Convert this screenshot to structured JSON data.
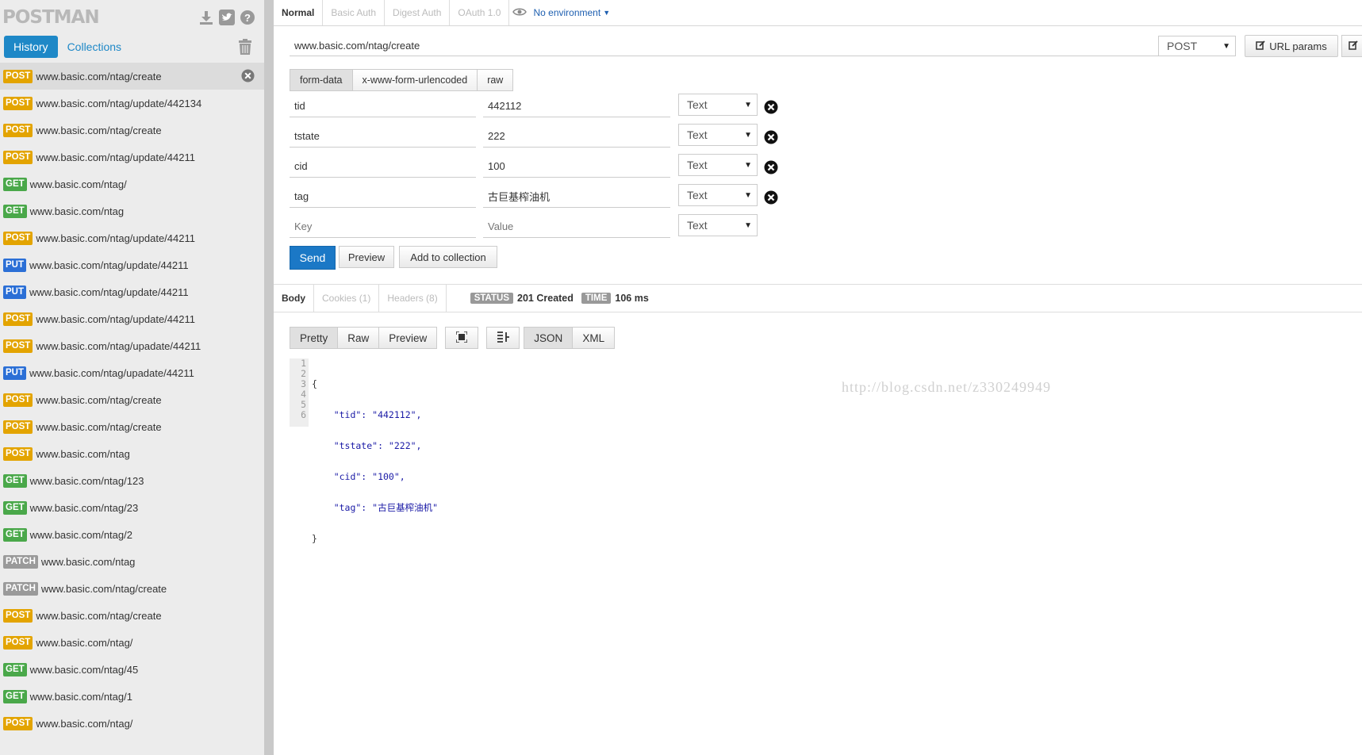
{
  "app": {
    "logo": "POSTMAN"
  },
  "sidebar": {
    "tabs": {
      "history": "History",
      "collections": "Collections"
    },
    "method_colors": {
      "POST": "#e3a400",
      "GET": "#4aa84a",
      "PUT": "#2b6fd6",
      "PATCH": "#9a9a9a"
    },
    "history": [
      {
        "method": "POST",
        "url": "www.basic.com/ntag/create"
      },
      {
        "method": "POST",
        "url": "www.basic.com/ntag/update/442134"
      },
      {
        "method": "POST",
        "url": "www.basic.com/ntag/create"
      },
      {
        "method": "POST",
        "url": "www.basic.com/ntag/update/44211"
      },
      {
        "method": "GET",
        "url": "www.basic.com/ntag/"
      },
      {
        "method": "GET",
        "url": "www.basic.com/ntag"
      },
      {
        "method": "POST",
        "url": "www.basic.com/ntag/update/44211"
      },
      {
        "method": "PUT",
        "url": "www.basic.com/ntag/update/44211"
      },
      {
        "method": "PUT",
        "url": "www.basic.com/ntag/update/44211"
      },
      {
        "method": "POST",
        "url": "www.basic.com/ntag/update/44211"
      },
      {
        "method": "POST",
        "url": "www.basic.com/ntag/upadate/44211"
      },
      {
        "method": "PUT",
        "url": "www.basic.com/ntag/upadate/44211"
      },
      {
        "method": "POST",
        "url": "www.basic.com/ntag/create"
      },
      {
        "method": "POST",
        "url": "www.basic.com/ntag/create"
      },
      {
        "method": "POST",
        "url": "www.basic.com/ntag"
      },
      {
        "method": "GET",
        "url": "www.basic.com/ntag/123"
      },
      {
        "method": "GET",
        "url": "www.basic.com/ntag/23"
      },
      {
        "method": "GET",
        "url": "www.basic.com/ntag/2"
      },
      {
        "method": "PATCH",
        "url": "www.basic.com/ntag"
      },
      {
        "method": "PATCH",
        "url": "www.basic.com/ntag/create"
      },
      {
        "method": "POST",
        "url": "www.basic.com/ntag/create"
      },
      {
        "method": "POST",
        "url": "www.basic.com/ntag/"
      },
      {
        "method": "GET",
        "url": "www.basic.com/ntag/45"
      },
      {
        "method": "GET",
        "url": "www.basic.com/ntag/1"
      },
      {
        "method": "POST",
        "url": "www.basic.com/ntag/"
      }
    ]
  },
  "auth_tabs": [
    "Normal",
    "Basic Auth",
    "Digest Auth",
    "OAuth 1.0"
  ],
  "environment": "No environment",
  "request": {
    "url": "www.basic.com/ntag/create",
    "method": "POST",
    "url_params_label": "URL params",
    "body_tabs": [
      "form-data",
      "x-www-form-urlencoded",
      "raw"
    ],
    "params": [
      {
        "key": "tid",
        "value": "442112",
        "type": "Text"
      },
      {
        "key": "tstate",
        "value": "222",
        "type": "Text"
      },
      {
        "key": "cid",
        "value": "100",
        "type": "Text"
      },
      {
        "key": "tag",
        "value": "古巨基榨油机",
        "type": "Text"
      }
    ],
    "new_row": {
      "key_placeholder": "Key",
      "value_placeholder": "Value",
      "type": "Text"
    },
    "send_label": "Send",
    "preview_label": "Preview",
    "add_to_collection_label": "Add to collection"
  },
  "response": {
    "tabs": [
      "Body",
      "Cookies (1)",
      "Headers (8)"
    ],
    "status_label": "STATUS",
    "status": "201 Created",
    "time_label": "TIME",
    "time": "106 ms",
    "view_buttons": [
      "Pretty",
      "Raw",
      "Preview"
    ],
    "format_buttons": [
      "JSON",
      "XML"
    ],
    "line_numbers": [
      "1",
      "2",
      "3",
      "4",
      "5",
      "6"
    ],
    "body_lines": [
      "{",
      "    \"tid\": \"442112\",",
      "    \"tstate\": \"222\",",
      "    \"cid\": \"100\",",
      "    \"tag\": \"古巨基榨油机\"",
      "}"
    ],
    "watermark": "http://blog.csdn.net/z330249949"
  }
}
